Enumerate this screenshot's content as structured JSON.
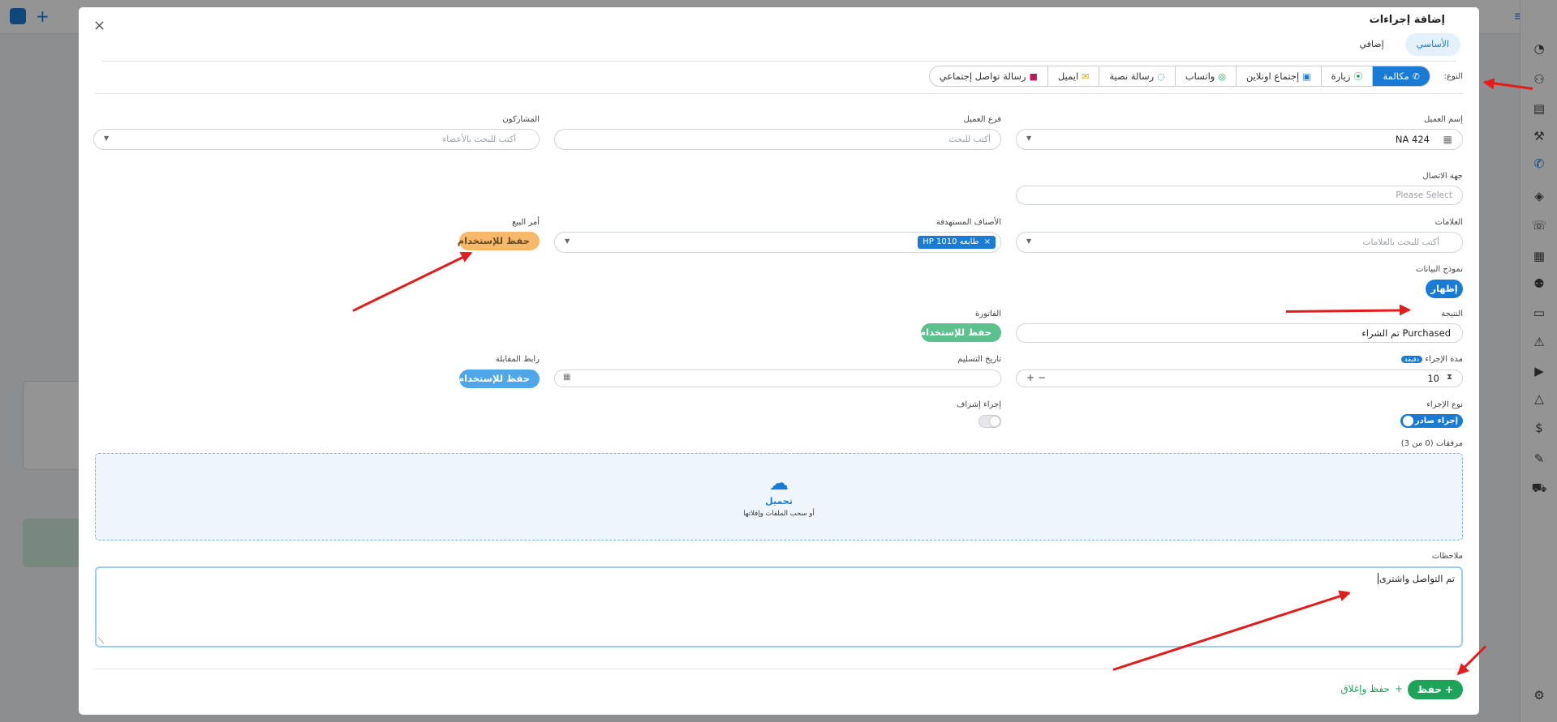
{
  "modal": {
    "title": "إضافة إجراءات",
    "close": "×",
    "tabs": [
      "الأساسي",
      "إضافي"
    ]
  },
  "type": {
    "label": "النوع:",
    "options": [
      {
        "label": "مكالمة",
        "icon": "phone-icon"
      },
      {
        "label": "زيارة",
        "icon": "location-pin-icon"
      },
      {
        "label": "إجتماع اونلاين",
        "icon": "presentation-icon"
      },
      {
        "label": "واتساب",
        "icon": "whatsapp-icon"
      },
      {
        "label": "رسالة نصية",
        "icon": "sms-icon"
      },
      {
        "label": "ايميل",
        "icon": "email-icon"
      },
      {
        "label": "رسالة تواصل إجتماعي",
        "icon": "social-icon"
      }
    ]
  },
  "fields": {
    "client_name_label": "إسم العميل",
    "client_name_value": "NA 424",
    "client_branch_label": "فرع العميل",
    "client_branch_placeholder": "أكتب للبحث",
    "participants_label": "المشاركون",
    "participants_placeholder": "أكتب للبحث بالأعضاء",
    "contact_label": "جهة الاتصال",
    "contact_placeholder": "Please Select",
    "tags_label": "العلامات",
    "tags_placeholder": "أكتب للبحث بالعلامات",
    "target_items_label": "الأصناف المستهدفة",
    "target_item_chip": "طابعه HP 1010",
    "sales_order_label": "أمر البيع",
    "sales_order_button": "حفظ للإستخدام",
    "data_model_label": "نموذج البيانات",
    "data_model_button": "إظهار",
    "result_label": "النتيجة",
    "result_value": "Purchased تم الشراء",
    "invoice_label": "الفاتورة",
    "invoice_button": "حفظ للإستخدام",
    "duration_label": "مدة الإجراء",
    "duration_unit": "دقيقة",
    "duration_value": "10",
    "delivery_date_label": "تاريخ التسليم",
    "meeting_link_label": "رابط المقابلة",
    "meeting_link_button": "حفظ للإستخدام",
    "action_type_label": "نوع الإجراء",
    "action_type_toggle": "إجراء صادر",
    "supervision_label": "إجراء إشراف",
    "attachments_label": "مرفقات (0 من 3)",
    "upload_title": "تحميل",
    "upload_hint": "أو سحب الملفات وإفلاتها",
    "notes_label": "ملاحظات",
    "notes_value": "تم التواصل واشترى"
  },
  "footer": {
    "save": "حفظ",
    "save_close": "حفظ وإغلاق"
  },
  "colors": {
    "primary": "#1a7bd5",
    "success": "#1ea35b",
    "warning": "#f6b96b",
    "annotation": "#e31c1c"
  }
}
